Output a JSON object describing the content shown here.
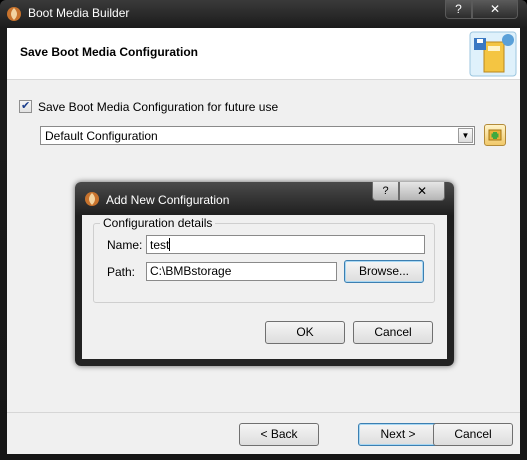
{
  "window": {
    "title": "Boot Media Builder",
    "help_glyph": "?",
    "close_glyph": "✕"
  },
  "header": {
    "title": "Save Boot Media Configuration",
    "graphic_icon": "config-wizard-icon"
  },
  "save_option": {
    "checked": true,
    "label": "Save Boot Media Configuration for future use"
  },
  "configuration": {
    "selected": "Default Configuration"
  },
  "footer": {
    "back_label": "< Back",
    "next_label": "Next >",
    "cancel_label": "Cancel"
  },
  "dialog": {
    "title": "Add New Configuration",
    "help_glyph": "?",
    "close_glyph": "✕",
    "group_label": "Configuration details",
    "name_label": "Name:",
    "name_value": "test",
    "path_label": "Path:",
    "path_value": "C:\\BMBstorage",
    "browse_label": "Browse...",
    "ok_label": "OK",
    "cancel_label": "Cancel"
  },
  "colors": {
    "dialog_frame": "#2b2b2b",
    "accent_border": "#3c7fb1",
    "client_bg": "#f0f0f0"
  }
}
